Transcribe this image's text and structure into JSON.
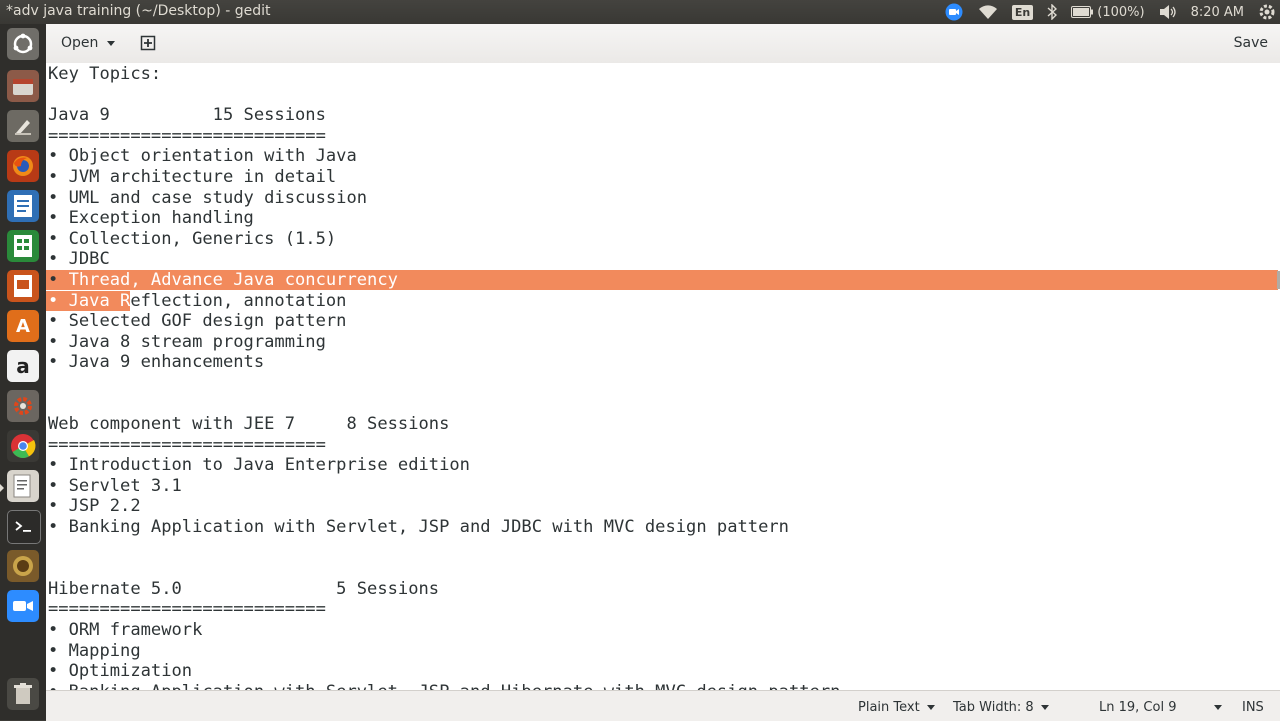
{
  "window": {
    "title": "*adv java training (~/Desktop) - gedit"
  },
  "indicators": {
    "language": "En",
    "battery": "(100%)",
    "clock": "8:20 AM",
    "icons": [
      "zoom-icon",
      "wifi-icon",
      "keyboard-language-icon",
      "bluetooth-icon",
      "battery-icon",
      "volume-icon",
      "gear-icon"
    ]
  },
  "launcher": {
    "items": [
      "ubuntu-dash-icon",
      "files-icon",
      "paint-tool-icon",
      "firefox-icon",
      "writer-icon",
      "calc-icon",
      "impress-icon",
      "software-center-icon",
      "amazon-icon",
      "system-settings-icon",
      "chrome-icon",
      "text-editor-icon",
      "terminal-icon",
      "badge-app-icon",
      "zoom-app-icon",
      "trash-icon"
    ]
  },
  "header": {
    "open_label": "Open",
    "save_label": "Save"
  },
  "editor": {
    "lines": [
      "Key Topics:",
      "",
      "Java 9          15 Sessions",
      "===========================",
      "• Object orientation with Java",
      "• JVM architecture in detail",
      "• UML and case study discussion",
      "• Exception handling",
      "• Collection, Generics (1.5)",
      "• JDBC",
      "• Thread, Advance Java concurrency",
      "• Java Reflection, annotation",
      "• Selected GOF design pattern",
      "• Java 8 stream programming",
      "• Java 9 enhancements",
      "",
      "",
      "Web component with JEE 7     8 Sessions",
      "===========================",
      "• Introduction to Java Enterprise edition",
      "• Servlet 3.1",
      "• JSP 2.2",
      "• Banking Application with Servlet, JSP and JDBC with MVC design pattern",
      "",
      "",
      "Hibernate 5.0               5 Sessions",
      "===========================",
      "• ORM framework",
      "• Mapping",
      "• Optimization",
      "• Banking Application with Servlet, JSP and Hibernate with MVC design pattern"
    ]
  },
  "status": {
    "language": "Plain Text",
    "tab_width": "Tab Width: 8",
    "position": "Ln 19, Col 9",
    "mode": "INS"
  },
  "colors": {
    "selection": "#f28a5c",
    "panel": "#3c3b37",
    "launcher": "#2f2e2b"
  }
}
